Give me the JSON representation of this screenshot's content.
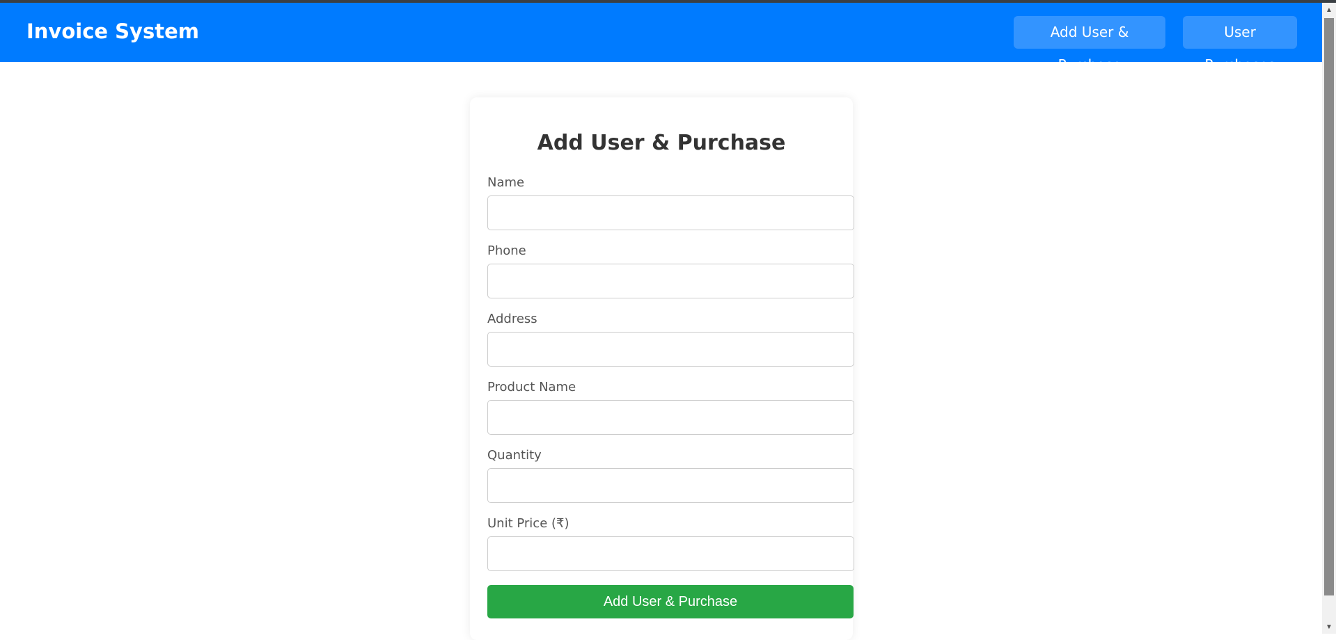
{
  "app": {
    "title": "Invoice System"
  },
  "nav": {
    "items": [
      {
        "label": "Add User & Purchase"
      },
      {
        "label": "User Purchases"
      }
    ]
  },
  "form": {
    "title": "Add User & Purchase",
    "fields": [
      {
        "label": "Name",
        "value": "",
        "placeholder": ""
      },
      {
        "label": "Phone",
        "value": "",
        "placeholder": ""
      },
      {
        "label": "Address",
        "value": "",
        "placeholder": ""
      },
      {
        "label": "Product Name",
        "value": "",
        "placeholder": ""
      },
      {
        "label": "Quantity",
        "value": "",
        "placeholder": ""
      },
      {
        "label": "Unit Price (₹)",
        "value": "",
        "placeholder": ""
      }
    ],
    "submit_label": "Add User & Purchase"
  },
  "colors": {
    "navbar": "#007bff",
    "nav_button": "#3394ff",
    "submit": "#28a745"
  }
}
